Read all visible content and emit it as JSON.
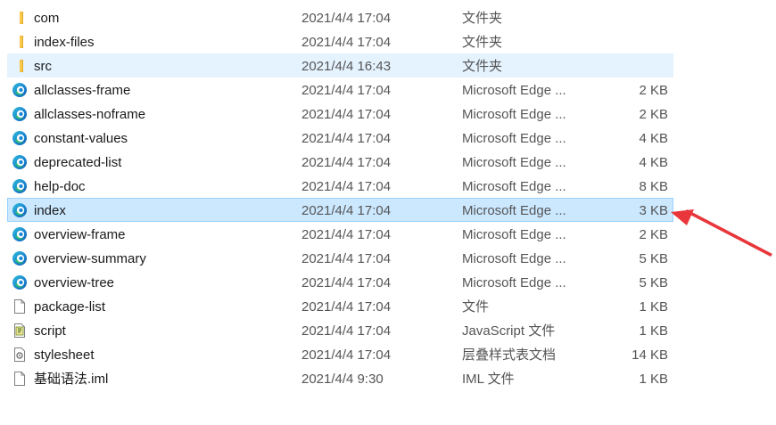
{
  "files": [
    {
      "name": "com",
      "date": "2021/4/4 17:04",
      "type": "文件夹",
      "size": "",
      "icon": "folder-icon",
      "state": ""
    },
    {
      "name": "index-files",
      "date": "2021/4/4 17:04",
      "type": "文件夹",
      "size": "",
      "icon": "folder-icon",
      "state": ""
    },
    {
      "name": "src",
      "date": "2021/4/4 16:43",
      "type": "文件夹",
      "size": "",
      "icon": "folder-icon",
      "state": "hover"
    },
    {
      "name": "allclasses-frame",
      "date": "2021/4/4 17:04",
      "type": "Microsoft Edge ...",
      "size": "2 KB",
      "icon": "edge-icon",
      "state": ""
    },
    {
      "name": "allclasses-noframe",
      "date": "2021/4/4 17:04",
      "type": "Microsoft Edge ...",
      "size": "2 KB",
      "icon": "edge-icon",
      "state": ""
    },
    {
      "name": "constant-values",
      "date": "2021/4/4 17:04",
      "type": "Microsoft Edge ...",
      "size": "4 KB",
      "icon": "edge-icon",
      "state": ""
    },
    {
      "name": "deprecated-list",
      "date": "2021/4/4 17:04",
      "type": "Microsoft Edge ...",
      "size": "4 KB",
      "icon": "edge-icon",
      "state": ""
    },
    {
      "name": "help-doc",
      "date": "2021/4/4 17:04",
      "type": "Microsoft Edge ...",
      "size": "8 KB",
      "icon": "edge-icon",
      "state": ""
    },
    {
      "name": "index",
      "date": "2021/4/4 17:04",
      "type": "Microsoft Edge ...",
      "size": "3 KB",
      "icon": "edge-icon",
      "state": "selected"
    },
    {
      "name": "overview-frame",
      "date": "2021/4/4 17:04",
      "type": "Microsoft Edge ...",
      "size": "2 KB",
      "icon": "edge-icon",
      "state": ""
    },
    {
      "name": "overview-summary",
      "date": "2021/4/4 17:04",
      "type": "Microsoft Edge ...",
      "size": "5 KB",
      "icon": "edge-icon",
      "state": ""
    },
    {
      "name": "overview-tree",
      "date": "2021/4/4 17:04",
      "type": "Microsoft Edge ...",
      "size": "5 KB",
      "icon": "edge-icon",
      "state": ""
    },
    {
      "name": "package-list",
      "date": "2021/4/4 17:04",
      "type": "文件",
      "size": "1 KB",
      "icon": "file-icon",
      "state": ""
    },
    {
      "name": "script",
      "date": "2021/4/4 17:04",
      "type": "JavaScript 文件",
      "size": "1 KB",
      "icon": "script-icon",
      "state": ""
    },
    {
      "name": "stylesheet",
      "date": "2021/4/4 17:04",
      "type": "层叠样式表文档",
      "size": "14 KB",
      "icon": "stylesheet-icon",
      "state": ""
    },
    {
      "name": "基础语法.iml",
      "date": "2021/4/4 9:30",
      "type": "IML 文件",
      "size": "1 KB",
      "icon": "file-icon",
      "state": ""
    }
  ],
  "colors": {
    "hover": "#e5f3ff",
    "selected": "#cce8ff",
    "selected_border": "#99d1ff",
    "arrow": "#e8363a",
    "folder": "#f8c84a"
  },
  "annotation": {
    "icon": "red-arrow-annotation",
    "points_to": "index"
  }
}
